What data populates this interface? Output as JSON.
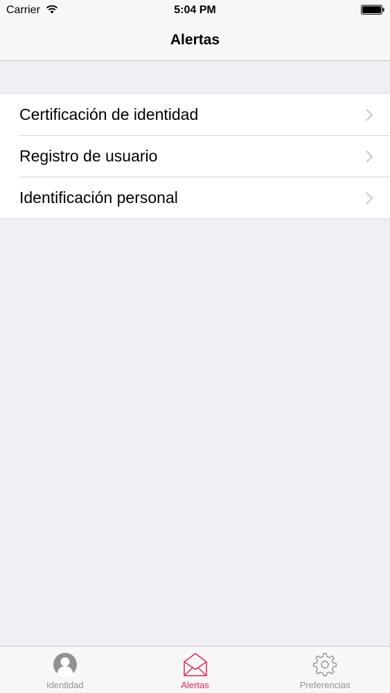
{
  "status_bar": {
    "carrier": "Carrier",
    "time": "5:04 PM",
    "wifi_icon": "wifi-icon",
    "battery_icon": "battery-icon"
  },
  "nav": {
    "title": "Alertas"
  },
  "list": {
    "items": [
      {
        "label": "Certificación de identidad",
        "icon": "chevron-right-icon"
      },
      {
        "label": "Registro de usuario",
        "icon": "chevron-right-icon"
      },
      {
        "label": "Identificación personal",
        "icon": "chevron-right-icon"
      }
    ]
  },
  "tabbar": {
    "tabs": [
      {
        "label": "Identidad",
        "icon": "person-icon",
        "active": false
      },
      {
        "label": "Alertas",
        "icon": "envelope-icon",
        "active": true
      },
      {
        "label": "Preferencias",
        "icon": "gear-icon",
        "active": false
      }
    ]
  },
  "colors": {
    "accent": "#e0275a",
    "inactive": "#929292",
    "background": "#efeff4"
  }
}
